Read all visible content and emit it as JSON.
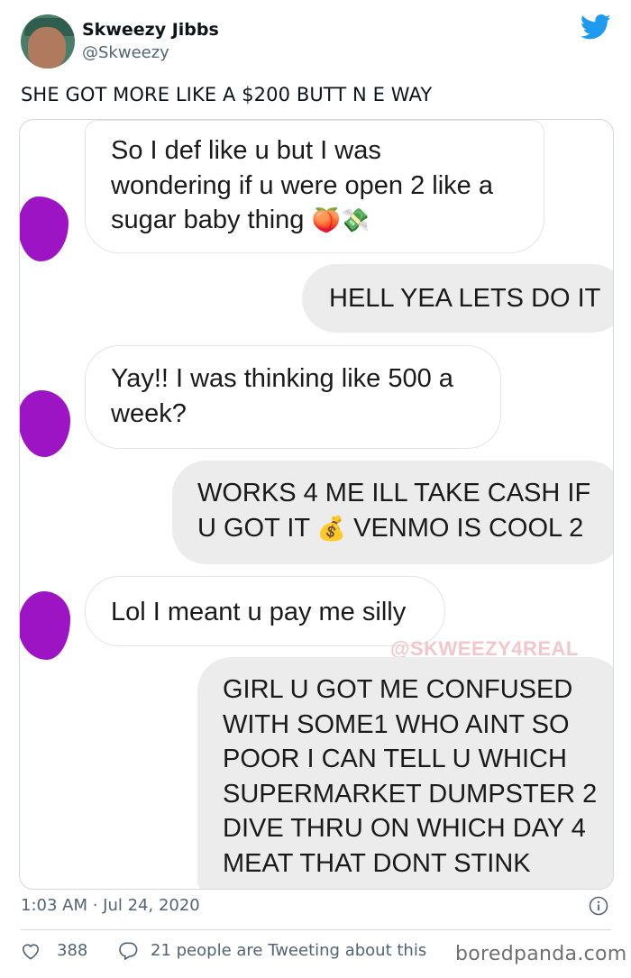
{
  "tweet": {
    "display_name": "Skweezy Jibbs",
    "handle": "@Skweezy",
    "text": "SHE GOT MORE LIKE A $200 BUTT N E WAY",
    "timestamp": "1:03 AM · Jul 24, 2020",
    "likes": "388",
    "conversation": "21 people are Tweeting about this"
  },
  "icons": {
    "brand": "twitter-bird-icon",
    "info": "info-icon",
    "like": "heart-icon",
    "reply": "speech-bubble-icon"
  },
  "colors": {
    "twitter_blue": "#1d9bf0",
    "redaction_purple": "#9d14c4",
    "outgoing_bubble": "#ececec",
    "watermark": "#f3c6cb"
  },
  "conversation": {
    "messages": [
      {
        "from": "them",
        "lines": [
          "So I def like u but I was",
          "wondering if u were open 2 like a",
          "sugar baby thing"
        ],
        "emoji": [
          "🍑",
          "💸"
        ]
      },
      {
        "from": "me",
        "lines": [
          "HELL YEA LETS DO IT"
        ]
      },
      {
        "from": "them",
        "lines": [
          "Yay!! I was thinking like 500 a",
          "week?"
        ]
      },
      {
        "from": "me",
        "lines": [
          "WORKS 4 ME ILL TAKE CASH IF",
          "U GOT IT",
          "VENMO IS COOL 2"
        ],
        "emoji": [
          "💰"
        ]
      },
      {
        "from": "them",
        "lines": [
          "Lol I meant u pay me silly"
        ]
      },
      {
        "from": "me",
        "lines": [
          "GIRL U GOT ME CONFUSED",
          "WITH SOME1 WHO AINT SO",
          "POOR I CAN TELL U WHICH",
          "SUPERMARKET DUMPSTER 2",
          "DIVE THRU ON WHICH DAY 4",
          "MEAT THAT DONT STINK"
        ]
      }
    ],
    "watermark": "@SKWEEZY4REAL"
  },
  "source": {
    "watermark": "boredpanda.com"
  }
}
